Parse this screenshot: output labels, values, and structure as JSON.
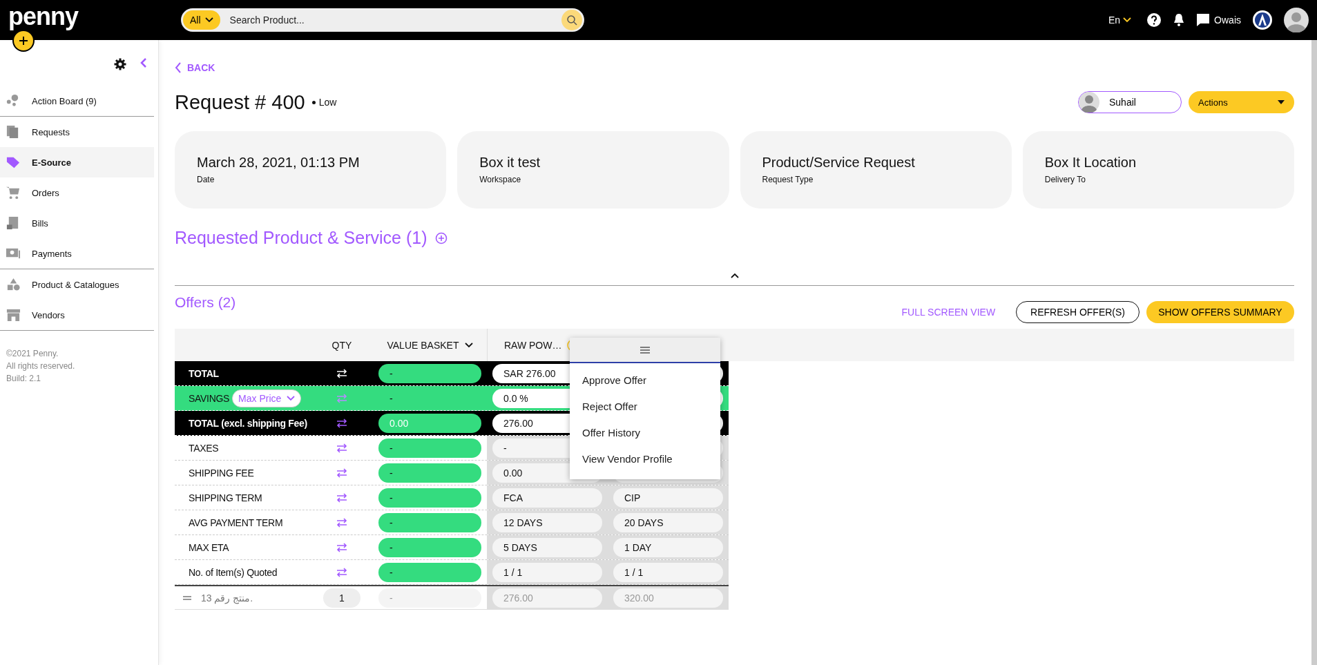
{
  "header": {
    "logo": "penny",
    "filter": "All",
    "search_placeholder": "Search Product...",
    "language": "En",
    "user": "Owais"
  },
  "sidebar": {
    "groups": [
      [
        {
          "label": "Action Board (9)",
          "selected": false
        }
      ],
      [
        {
          "label": "Requests",
          "selected": false
        },
        {
          "label": "E-Source",
          "selected": true
        },
        {
          "label": "Orders",
          "selected": false
        },
        {
          "label": "Bills",
          "selected": false
        },
        {
          "label": "Payments",
          "selected": false
        }
      ],
      [
        {
          "label": "Product & Catalogues",
          "selected": false
        },
        {
          "label": "Vendors",
          "selected": false
        }
      ]
    ],
    "footer": [
      "©2021 Penny.",
      "All rights reserved.",
      "Build: 2.1"
    ]
  },
  "page": {
    "back": "BACK",
    "title": "Request # 400",
    "priority": "Low",
    "assignee": "Suhail",
    "actions": "Actions",
    "cards": [
      {
        "value": "March 28, 2021, 01:13 PM",
        "label": "Date"
      },
      {
        "value": "Box it test",
        "label": "Workspace"
      },
      {
        "value": "Product/Service Request",
        "label": "Request Type"
      },
      {
        "value": "Box It Location",
        "label": "Delivery To"
      }
    ],
    "requested_title": "Requested Product & Service (1)",
    "offers_title": "Offers (2)",
    "full_screen": "FULL SCREEN VIEW",
    "refresh": "REFRESH OFFER(S)",
    "summary": "SHOW OFFERS SUMMARY"
  },
  "table": {
    "columns": [
      "QTY",
      "VALUE BASKET",
      "RAW POW…"
    ],
    "rows": [
      {
        "kind": "total",
        "label": "TOTAL",
        "basket": "-",
        "offer_1": "SAR 276.00"
      },
      {
        "kind": "savings",
        "label": "SAVINGS",
        "dropdown": "Max Price",
        "basket": "-",
        "offer_1": "0.0 %"
      },
      {
        "kind": "subtotal",
        "label": "TOTAL (excl. shipping Fee)",
        "basket": "0.00",
        "offer_1": "276.00"
      },
      {
        "kind": "plain",
        "label": "TAXES",
        "basket": "-",
        "offer_1": "-"
      },
      {
        "kind": "plain",
        "label": "SHIPPING FEE",
        "basket": "-",
        "offer_1": "0.00"
      },
      {
        "kind": "plain",
        "label": "SHIPPING TERM",
        "basket": "-",
        "offer_1": "FCA",
        "offer_2": "CIP"
      },
      {
        "kind": "plain",
        "label": "AVG PAYMENT TERM",
        "basket": "-",
        "offer_1": "12 DAYS",
        "offer_2": "20 DAYS"
      },
      {
        "kind": "plain",
        "label": "MAX ETA",
        "basket": "-",
        "offer_1": "5 DAYS",
        "offer_2": "1 DAY"
      },
      {
        "kind": "plain",
        "label": "No. of Item(s) Quoted",
        "basket": "-",
        "offer_1": "1 / 1",
        "offer_2": "1 / 1"
      }
    ],
    "items": [
      {
        "name": "منتج رقم 13.",
        "qty": "1",
        "basket": "-",
        "offer_1": "276.00",
        "offer_2": "320.00"
      }
    ]
  },
  "menu": {
    "items": [
      "Approve Offer",
      "Reject Offer",
      "Offer History",
      "View Vendor Profile"
    ]
  }
}
